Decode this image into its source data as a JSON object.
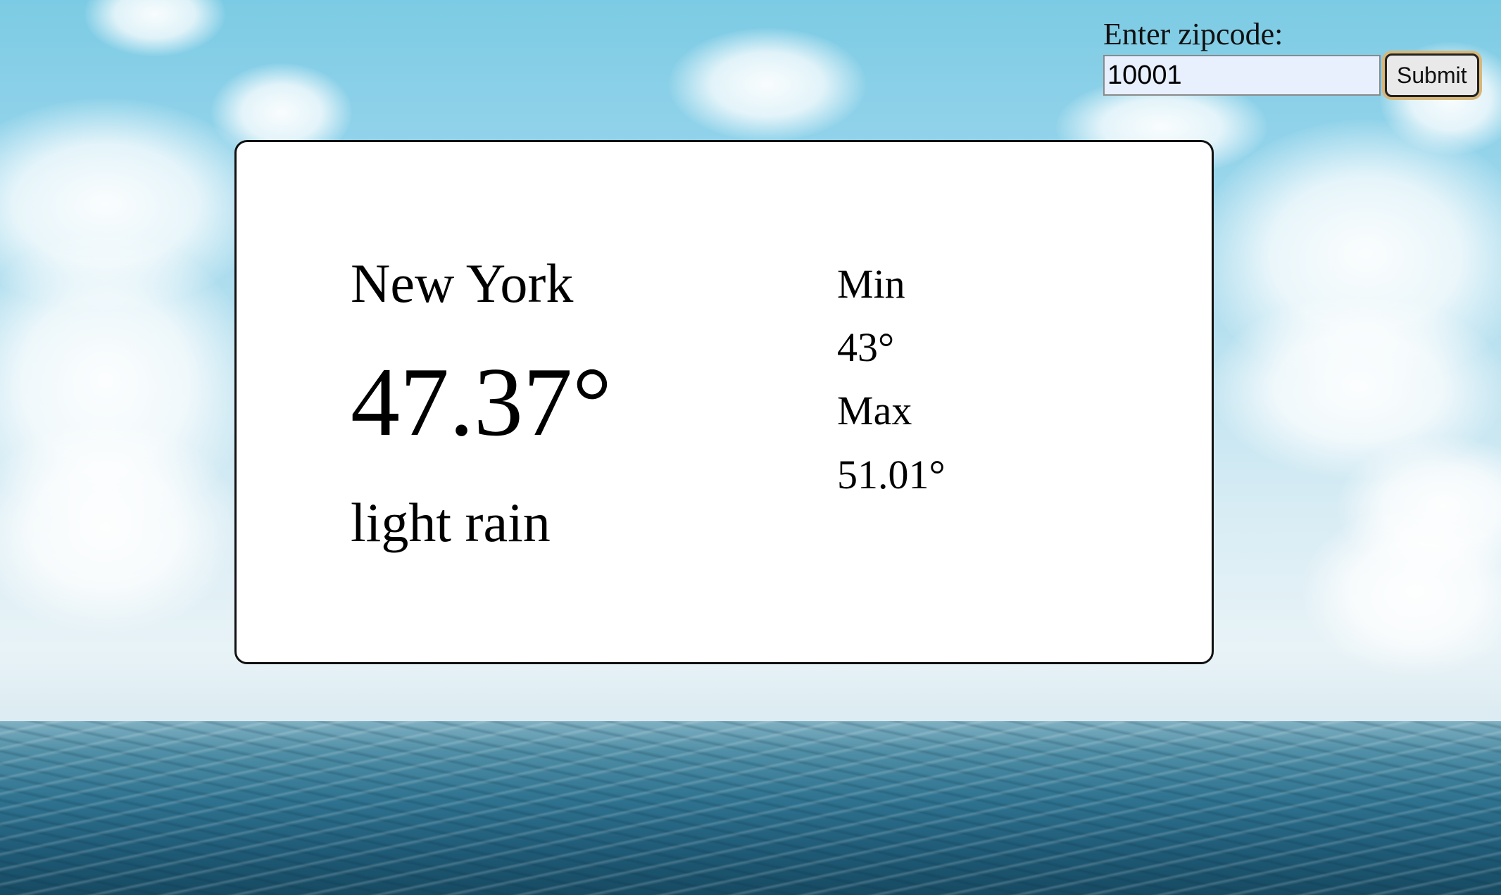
{
  "form": {
    "label": "Enter zipcode:",
    "input_value": "10001",
    "submit_label": "Submit"
  },
  "weather": {
    "city": "New York",
    "temperature": "47.37°",
    "description": "light rain",
    "min_label": "Min",
    "min_value": "43°",
    "max_label": "Max",
    "max_value": "51.01°"
  },
  "colors": {
    "card_background": "#ffffff",
    "card_border": "#111111",
    "input_background": "#e8f0fe",
    "submit_focus_ring": "#d8b77a"
  }
}
